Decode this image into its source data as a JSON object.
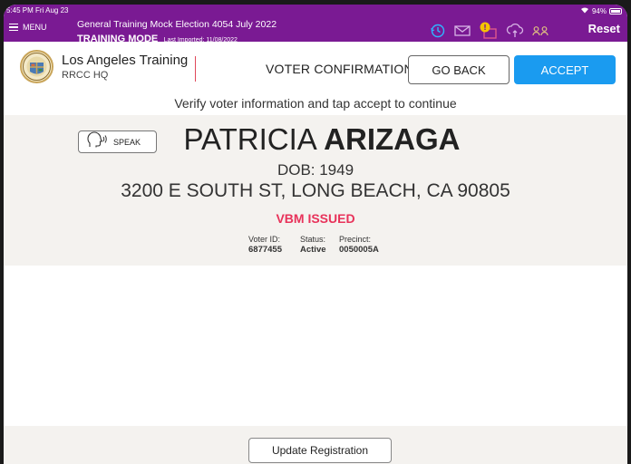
{
  "status_bar": {
    "time_date": "5:45 PM  Fri Aug 23",
    "battery": "94%"
  },
  "topbar": {
    "menu_label": "MENU",
    "election_title": "General Training Mock Election 4054  July 2022",
    "mode_label": "TRAINING MODE",
    "last_imported": "Last Imported: 11/08/2022",
    "reset_label": "Reset",
    "icons": [
      "history-icon",
      "mail-icon",
      "alert-ballot-icon",
      "cloud-sync-icon",
      "users-icon"
    ],
    "colors": {
      "bar": "#7a1a93",
      "alert": "#f5c400"
    }
  },
  "header": {
    "location_name": "Los Angeles Training",
    "location_sub": "RRCC HQ",
    "screen_title": "VOTER CONFIRMATION",
    "go_back_label": "GO BACK",
    "accept_label": "ACCEPT",
    "accent": "#1a9bf0"
  },
  "instruction": "Verify voter information and tap accept to continue",
  "voter": {
    "speak_label": "SPEAK",
    "first_name": "PATRICIA",
    "last_name": "ARIZAGA",
    "dob": "DOB: 1949",
    "address": "3200 E SOUTH ST, LONG BEACH, CA 90805",
    "vbm_status": "VBM ISSUED",
    "vbm_color": "#e8325a",
    "voter_id_label": "Voter ID:",
    "voter_id": "6877455",
    "status_label": "Status:",
    "status": "Active",
    "precinct_label": "Precinct:",
    "precinct": "0050005A"
  },
  "footer": {
    "update_label": "Update Registration"
  }
}
